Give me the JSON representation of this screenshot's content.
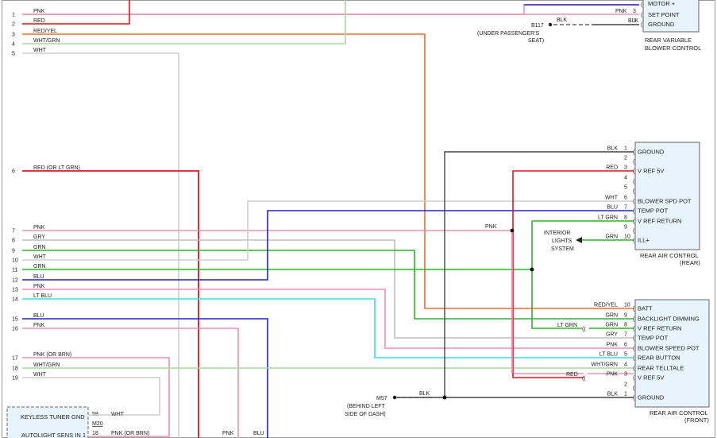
{
  "diagram": {
    "left_wires": [
      {
        "pin": "1",
        "label": "PNK",
        "color": "#f28fb0"
      },
      {
        "pin": "2",
        "label": "RED",
        "color": "#e0141e"
      },
      {
        "pin": "3",
        "label": "RED/YEL",
        "color": "#f26a2e"
      },
      {
        "pin": "4",
        "label": "WHT/GRN",
        "color": "#a8d8a0"
      },
      {
        "pin": "5",
        "label": "WHT",
        "color": "#cfcfcf"
      },
      {
        "pin": "6",
        "label": "RED (OR LT GRN)",
        "color": "#e0141e"
      },
      {
        "pin": "7",
        "label": "PNK",
        "color": "#f28fb0"
      },
      {
        "pin": "8",
        "label": "GRY",
        "color": "#bdbdbd"
      },
      {
        "pin": "9",
        "label": "GRN",
        "color": "#2ab52a"
      },
      {
        "pin": "10",
        "label": "WHT",
        "color": "#cfcfcf"
      },
      {
        "pin": "11",
        "label": "GRN",
        "color": "#2ab52a"
      },
      {
        "pin": "12",
        "label": "BLU",
        "color": "#2222d0"
      },
      {
        "pin": "13",
        "label": "PNK",
        "color": "#f28fb0"
      },
      {
        "pin": "14",
        "label": "LT BLU",
        "color": "#38e0e8"
      },
      {
        "pin": "15",
        "label": "BLU",
        "color": "#2222d0"
      },
      {
        "pin": "16",
        "label": "PNK",
        "color": "#f28fb0"
      },
      {
        "pin": "17",
        "label": "PNK (OR BRN)",
        "color": "#f28fb0"
      },
      {
        "pin": "18",
        "label": "WHT/GRN",
        "color": "#a8d8a0"
      },
      {
        "pin": "19",
        "label": "WHT",
        "color": "#cfcfcf"
      }
    ],
    "blower_control": {
      "pins": [
        {
          "num": "3",
          "wire": "PNK",
          "name": "SET POINT"
        },
        {
          "num": "1",
          "wire": "BLK",
          "name": "GROUND"
        }
      ],
      "top_label": "MOTOR +",
      "caption": [
        "REAR VARIABLE",
        "BLOWER CONTROL"
      ]
    },
    "ground_b117": {
      "id": "B117",
      "note": [
        "(UNDER PASSENGER'S",
        "SEAT)"
      ],
      "wire": "BLK"
    },
    "rear_ac": {
      "pins": [
        {
          "num": "1",
          "wire": "BLK",
          "name": "GROUND"
        },
        {
          "num": "2",
          "wire": "",
          "name": ""
        },
        {
          "num": "3",
          "wire": "RED",
          "name": "V REF 5V"
        },
        {
          "num": "4",
          "wire": "",
          "name": ""
        },
        {
          "num": "5",
          "wire": "",
          "name": ""
        },
        {
          "num": "6",
          "wire": "WHT",
          "name": "BLOWER SPD POT"
        },
        {
          "num": "7",
          "wire": "BLU",
          "name": "TEMP POT"
        },
        {
          "num": "8",
          "wire": "LT GRN",
          "name": "V REF RETURN"
        },
        {
          "num": "9",
          "wire": "",
          "name": ""
        },
        {
          "num": "10",
          "wire": "GRN",
          "name": "ILL+"
        }
      ],
      "caption": [
        "REAR AIR CONTROL",
        "(REAR)"
      ]
    },
    "interior_lights": [
      "INTERIOR",
      "LIGHTS",
      "SYSTEM"
    ],
    "splice_pnk_label": "PNK",
    "front_ac": {
      "pins": [
        {
          "num": "10",
          "wire": "RED/YEL",
          "name": "BATT"
        },
        {
          "num": "9",
          "wire": "GRN",
          "name": "BACKLIGHT DIMMING"
        },
        {
          "num": "8",
          "wire": "GRN",
          "name": "V REF RETURN"
        },
        {
          "num": "7",
          "wire": "GRY",
          "name": "TEMP POT"
        },
        {
          "num": "6",
          "wire": "PNK",
          "name": "BLOWER SPEED POT"
        },
        {
          "num": "5",
          "wire": "LT BLU",
          "name": "REAR BUTTON"
        },
        {
          "num": "4",
          "wire": "WHT/GRN",
          "name": "REAR TELLTALE"
        },
        {
          "num": "3",
          "wire": "PNK",
          "name": "V REF 5V"
        },
        {
          "num": "2",
          "wire": "",
          "name": ""
        },
        {
          "num": "1",
          "wire": "BLK",
          "name": "GROUND"
        }
      ],
      "lt_grn_label": "LT GRN",
      "red_label": "RED",
      "caption": [
        "REAR AIR CONTROL",
        "(FRONT)"
      ]
    },
    "ground_m57": {
      "id": "M57",
      "note": [
        "(BEHIND LEFT",
        "SIDE OF DASH)"
      ],
      "wire": "BLK"
    },
    "keyless": {
      "title": "KEYLESS TUNER GND",
      "pin58": "58",
      "wire58": "WHT",
      "connector": "M20",
      "bottom_label": "AUTOLIGHT SENS IN 1",
      "pin18": "18",
      "wire18": "PNK (OR BRN)"
    },
    "bottom_labels": {
      "pnk": "PNK",
      "blu": "BLU"
    }
  }
}
